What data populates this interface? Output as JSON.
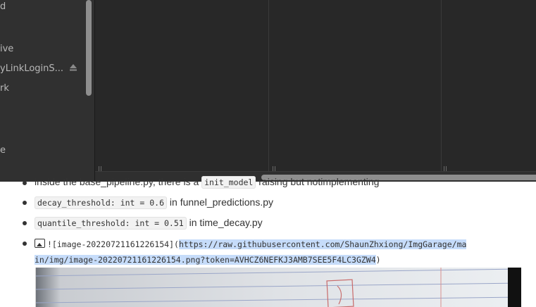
{
  "sidebar": {
    "items": [
      {
        "label": "d"
      },
      {
        "label": "ive"
      },
      {
        "label": "yLinkLoginS..."
      },
      {
        "label": "rk"
      },
      {
        "label": "e"
      }
    ]
  },
  "document": {
    "bullets": [
      {
        "prefix": "inside the base_pipeline.py, there is a ",
        "code": "init_model",
        "suffix": " raising but notimplementing"
      },
      {
        "code": "decay_threshold: int = 0.6",
        "suffix": " in funnel_predictions.py"
      },
      {
        "code": "quantile_threshold: int = 0.51",
        "suffix": " in time_decay.py"
      }
    ],
    "image_link": {
      "alt_part": "![image-20220721161226154](",
      "url_line1": "https://raw.githubusercontent.com/ShaunZhxiong/ImgGarage/ma",
      "url_line2": "in/img/image-20220721161226154.png?token=AVHCZ6NEFKJ3AMB7SEE5F4LC3GZW4",
      "close": ")"
    }
  },
  "colors": {
    "finder_bg": "#2b2b2b",
    "selection": "#c6dcfa",
    "text": "#333333"
  }
}
